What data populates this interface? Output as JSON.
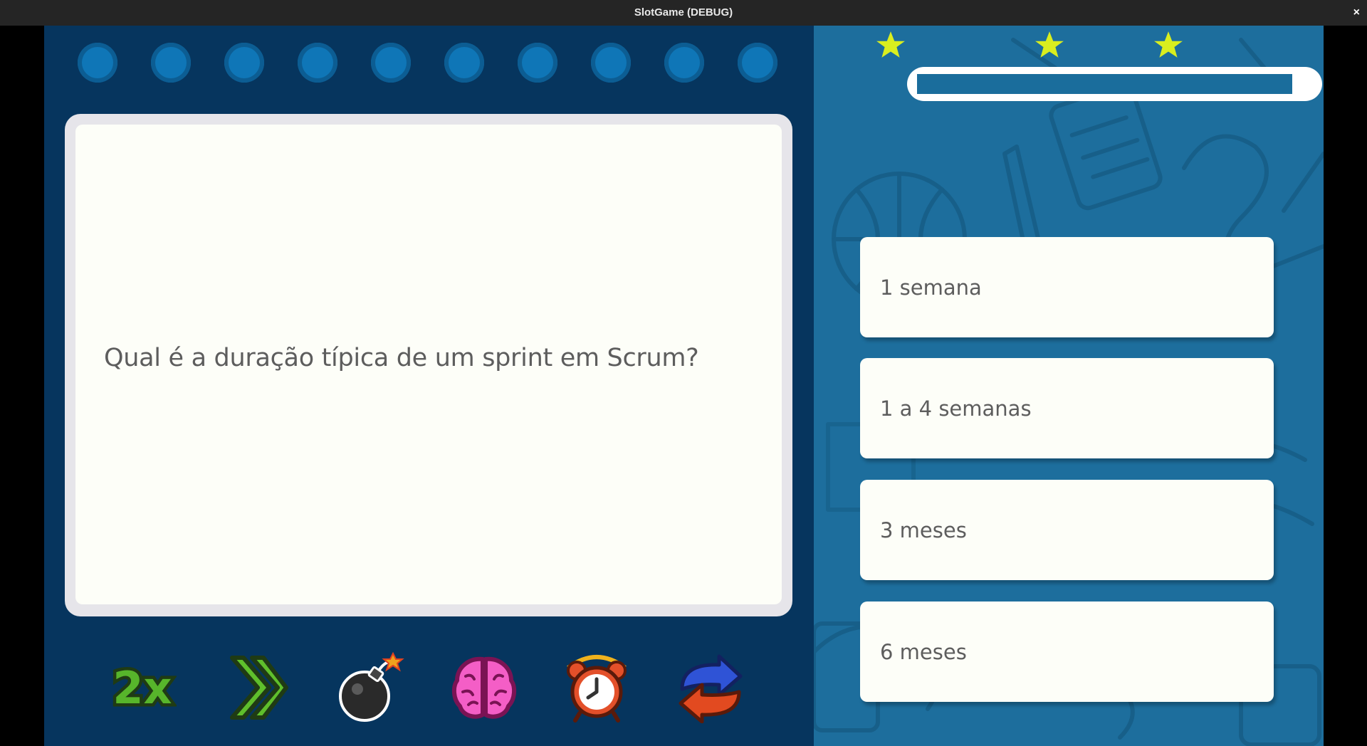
{
  "window": {
    "title": "SlotGame (DEBUG)",
    "close_glyph": "×"
  },
  "question": {
    "text": "Qual é a duração típica de um sprint em Scrum?"
  },
  "answers": [
    {
      "label": "1 semana"
    },
    {
      "label": "1 a 4 semanas"
    },
    {
      "label": "3 meses"
    },
    {
      "label": "6 meses"
    }
  ],
  "question_tracker": {
    "count": 10,
    "color": "#0f76b7"
  },
  "stars": {
    "count": 3,
    "color": "#d9ee1f"
  },
  "progress": {
    "fraction": 0.95
  },
  "powerups": [
    {
      "icon": "double-points-icon",
      "label_glyph": "2x"
    },
    {
      "icon": "skip-question-icon"
    },
    {
      "icon": "bomb-icon"
    },
    {
      "icon": "brain-icon"
    },
    {
      "icon": "alarm-clock-icon"
    },
    {
      "icon": "swap-question-icon"
    }
  ],
  "colors": {
    "left_panel": "#06355e",
    "right_panel": "#1d6e9d",
    "card": "#fdfef8",
    "text": "#5d5d5d"
  }
}
